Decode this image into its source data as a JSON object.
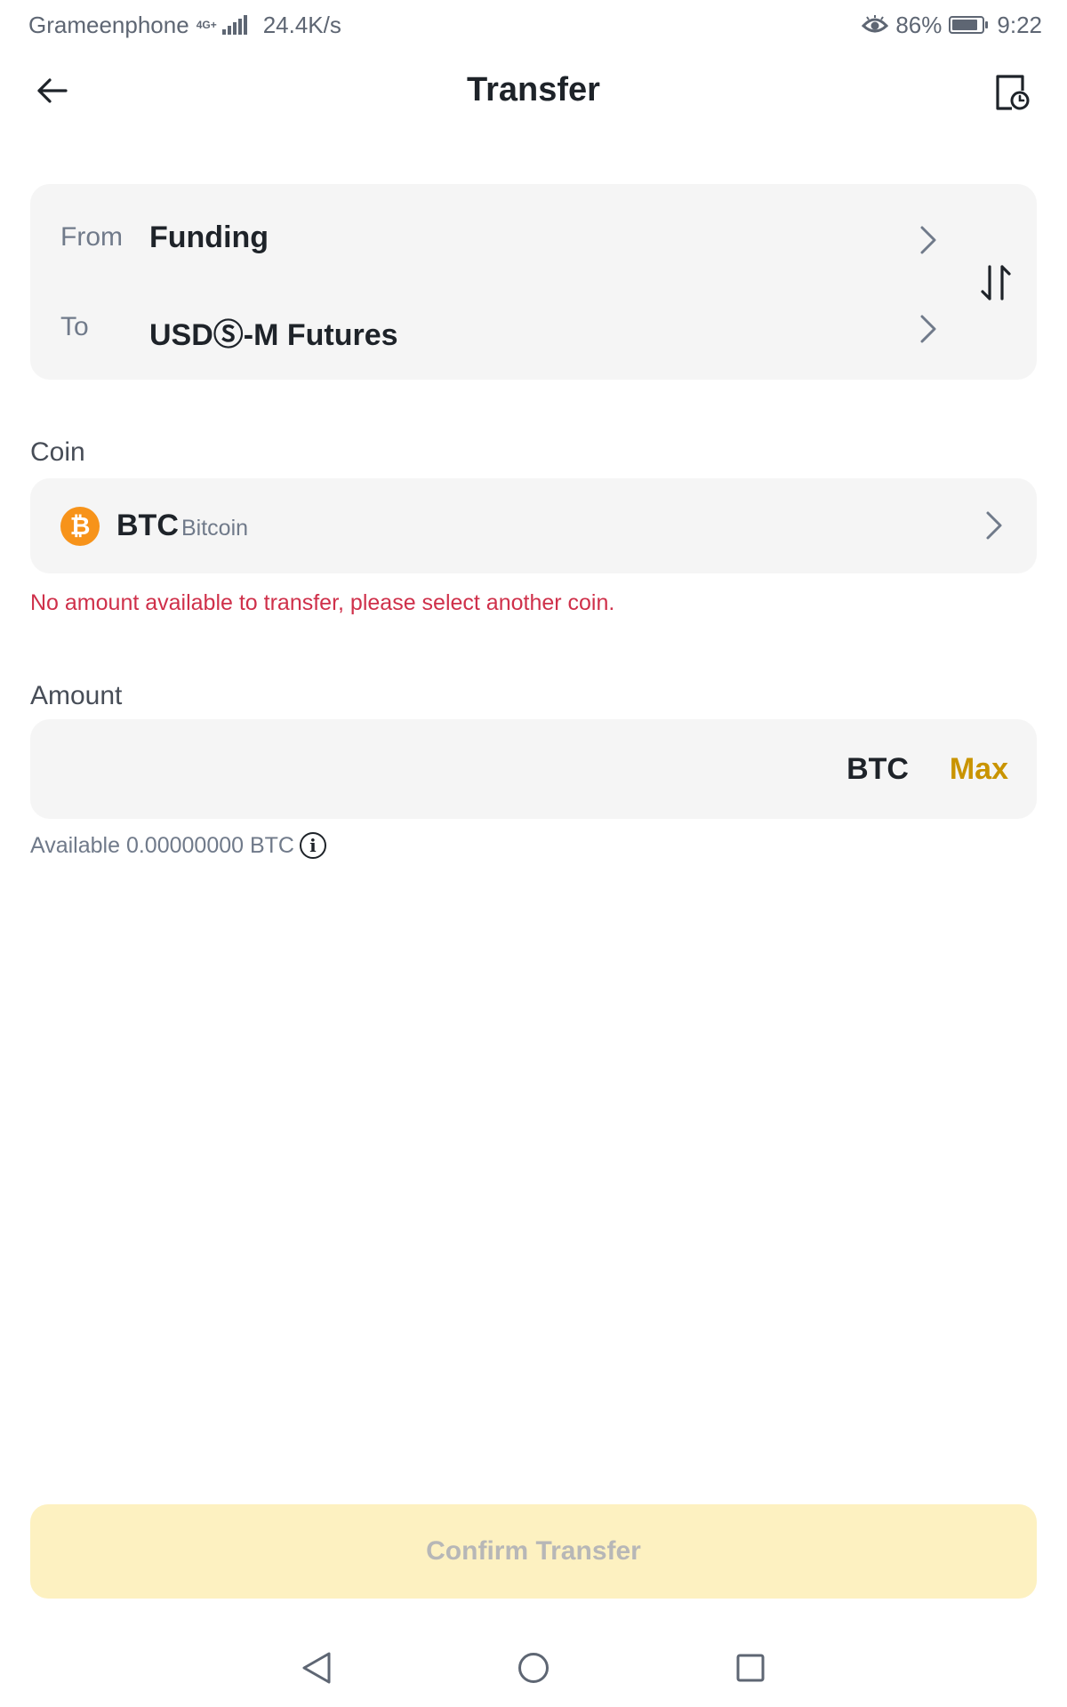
{
  "status_bar": {
    "carrier": "Grameenphone",
    "network_type": "4G+",
    "speed": "24.4K/s",
    "battery": "86%",
    "time": "9:22"
  },
  "header": {
    "title": "Transfer"
  },
  "route": {
    "from_label": "From",
    "from_value": "Funding",
    "to_label": "To",
    "to_value": "USDⓈ-M Futures"
  },
  "coin": {
    "section_label": "Coin",
    "symbol": "BTC",
    "name": "Bitcoin",
    "error": "No amount available to transfer, please select another coin."
  },
  "amount": {
    "section_label": "Amount",
    "value": "",
    "unit": "BTC",
    "max_label": "Max",
    "available_text": "Available 0.00000000 BTC"
  },
  "confirm": {
    "label": "Confirm Transfer"
  },
  "icons": {
    "back": "arrow-left-icon",
    "history": "history-icon",
    "swap": "swap-vertical-icon",
    "coin": "bitcoin-icon",
    "info": "info-icon"
  },
  "colors": {
    "accent": "#c99400",
    "error": "#cf304a",
    "confirm_bg": "#fdf1c1",
    "card_bg": "#f5f5f5",
    "bitcoin": "#f7931a"
  }
}
